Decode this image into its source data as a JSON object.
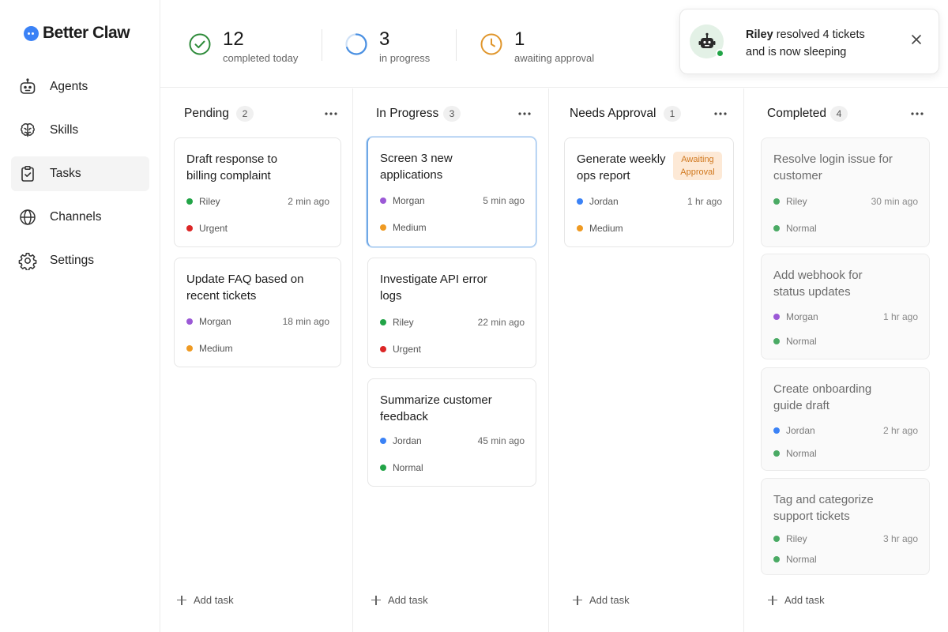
{
  "brand": {
    "name": "Better Claw"
  },
  "nav": [
    {
      "label": "Agents",
      "icon": "robot-icon"
    },
    {
      "label": "Skills",
      "icon": "brain-icon"
    },
    {
      "label": "Tasks",
      "icon": "clipboard-check-icon",
      "active": true
    },
    {
      "label": "Channels",
      "icon": "globe-icon"
    },
    {
      "label": "Settings",
      "icon": "gear-icon"
    }
  ],
  "stats": [
    {
      "value": "12",
      "label": "completed today",
      "icon": "check-circle-icon",
      "color": "#2e8b3a"
    },
    {
      "value": "3",
      "label": "in progress",
      "icon": "progress-ring-icon",
      "color": "#4a90e2"
    },
    {
      "value": "1",
      "label": "awaiting approval",
      "icon": "clock-icon",
      "color": "#e0962c"
    }
  ],
  "toast": {
    "name": "Riley",
    "line1_rest": " resolved 4 tickets",
    "line2": "and is now sleeping"
  },
  "colors": {
    "Riley": "#22a447",
    "Morgan": "#9b59d6",
    "Jordan": "#3b82f6",
    "Urgent": "#dc2626",
    "Medium": "#ef9a22",
    "Normal": "#22a447",
    "Normal_done": "#4aaa64"
  },
  "columns": [
    {
      "title": "Pending",
      "count": "2",
      "add_label": "Add task",
      "cards": [
        {
          "title": "Draft response to billing complaint",
          "assignee": "Riley",
          "time": "2 min ago",
          "priority": "Urgent"
        },
        {
          "title": "Update FAQ based on recent tickets",
          "assignee": "Morgan",
          "time": "18 min ago",
          "priority": "Medium"
        }
      ]
    },
    {
      "title": "In Progress",
      "count": "3",
      "add_label": "Add task",
      "cards": [
        {
          "title": "Screen 3 new applications",
          "assignee": "Morgan",
          "time": "5 min ago",
          "priority": "Medium"
        },
        {
          "title": "Investigate API error logs",
          "assignee": "Riley",
          "time": "22 min ago",
          "priority": "Urgent"
        },
        {
          "title": "Summarize customer feedback",
          "assignee": "Jordan",
          "time": "45 min ago",
          "priority": "Normal"
        }
      ]
    },
    {
      "title": "Needs Approval",
      "count": "1",
      "add_label": "Add task",
      "cards": [
        {
          "title": "Generate weekly ops report",
          "assignee": "Jordan",
          "time": "1 hr ago",
          "priority": "Medium",
          "badge": "Awaiting Approval"
        }
      ]
    },
    {
      "title": "Completed",
      "count": "4",
      "add_label": "Add task",
      "cards": [
        {
          "title": "Resolve login issue for customer",
          "assignee": "Riley",
          "time": "30 min ago",
          "priority": "Normal"
        },
        {
          "title": "Add webhook for status updates",
          "assignee": "Morgan",
          "time": "1 hr ago",
          "priority": "Normal"
        },
        {
          "title": "Create onboarding guide draft",
          "assignee": "Jordan",
          "time": "2 hr ago",
          "priority": "Normal"
        },
        {
          "title": "Tag and categorize support tickets",
          "assignee": "Riley",
          "time": "3 hr ago",
          "priority": "Normal"
        }
      ]
    }
  ]
}
